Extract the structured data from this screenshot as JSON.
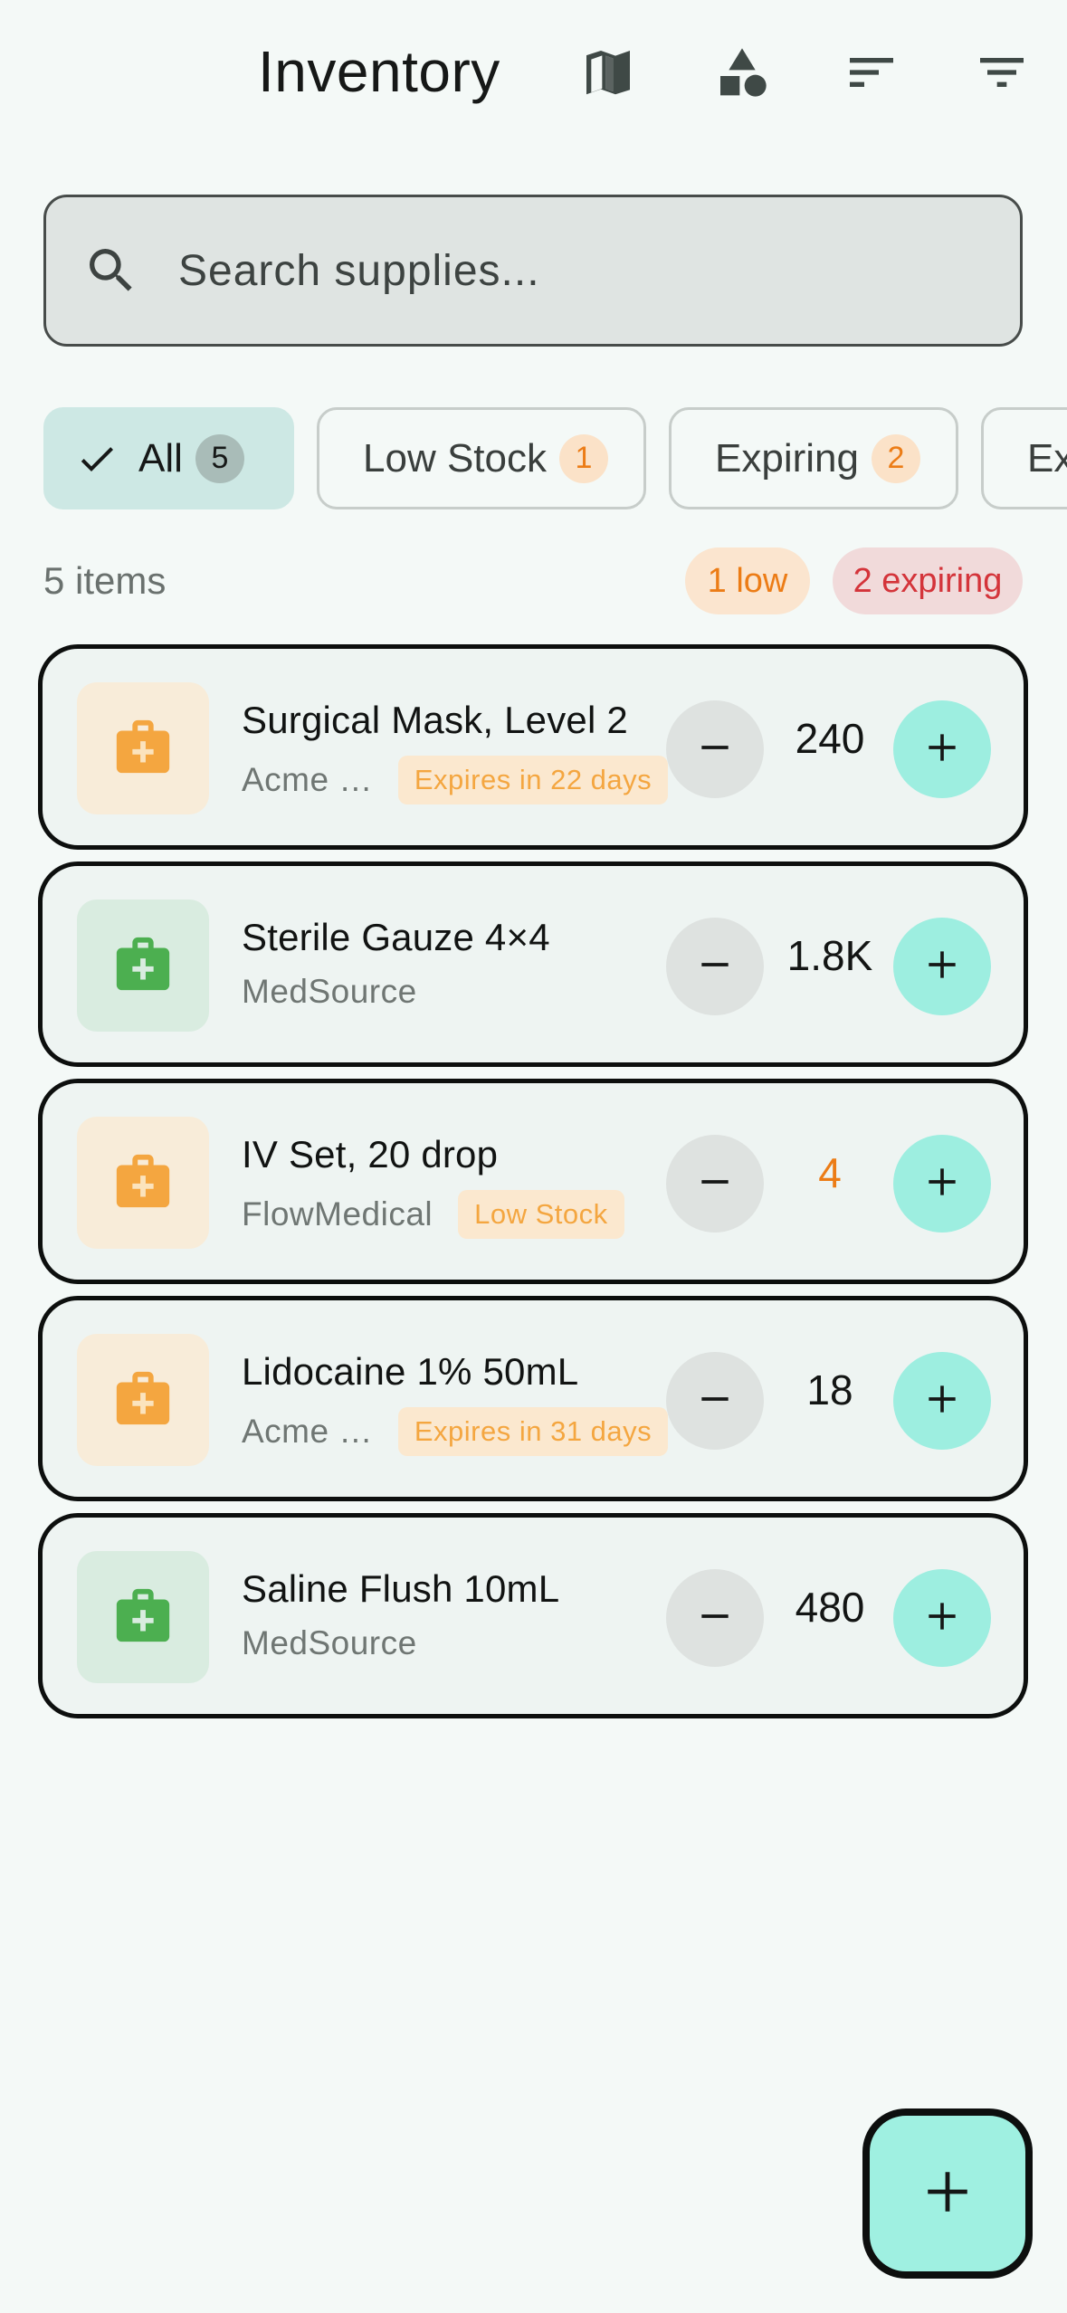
{
  "header": {
    "title": "Inventory",
    "actions": [
      {
        "icon": "map-icon"
      },
      {
        "icon": "category-shapes-icon"
      },
      {
        "icon": "sort-icon"
      },
      {
        "icon": "filter-icon"
      }
    ]
  },
  "search": {
    "placeholder": "Search supplies...",
    "value": ""
  },
  "filters": {
    "chips": [
      {
        "label": "All",
        "count": "5",
        "selected": true
      },
      {
        "label": "Low Stock",
        "count": "1",
        "selected": false
      },
      {
        "label": "Expiring",
        "count": "2",
        "selected": false
      },
      {
        "label": "Ex",
        "count": "",
        "selected": false
      }
    ]
  },
  "summary": {
    "items_count": "5 items",
    "low_pill": "1 low",
    "expiring_pill": "2 expiring"
  },
  "items": [
    {
      "name": "Surgical Mask, Level 2",
      "supplier": "Acme …",
      "badge": "Expires in 22 days",
      "quantity": "240",
      "icon_color": "#f4a640",
      "status": "expiring"
    },
    {
      "name": "Sterile Gauze 4×4",
      "supplier": "MedSource",
      "badge": "",
      "quantity": "1.8K",
      "icon_color": "#4caf50",
      "status": "ok"
    },
    {
      "name": "IV Set, 20 drop",
      "supplier": "FlowMedical",
      "badge": "Low Stock",
      "quantity": "4",
      "icon_color": "#f4a640",
      "status": "low"
    },
    {
      "name": "Lidocaine 1% 50mL",
      "supplier": "Acme …",
      "badge": "Expires in 31 days",
      "quantity": "18",
      "icon_color": "#f4a640",
      "status": "expiring"
    },
    {
      "name": "Saline Flush 10mL",
      "supplier": "MedSource",
      "badge": "",
      "quantity": "480",
      "icon_color": "#4caf50",
      "status": "ok"
    }
  ],
  "fab": {
    "icon": "add-icon"
  },
  "colors": {
    "background": "#f4f9f7",
    "accent_teal": "#9deee0",
    "warning_orange": "#ec7c16",
    "danger_red": "#d4343a",
    "ok_green": "#4caf50"
  }
}
